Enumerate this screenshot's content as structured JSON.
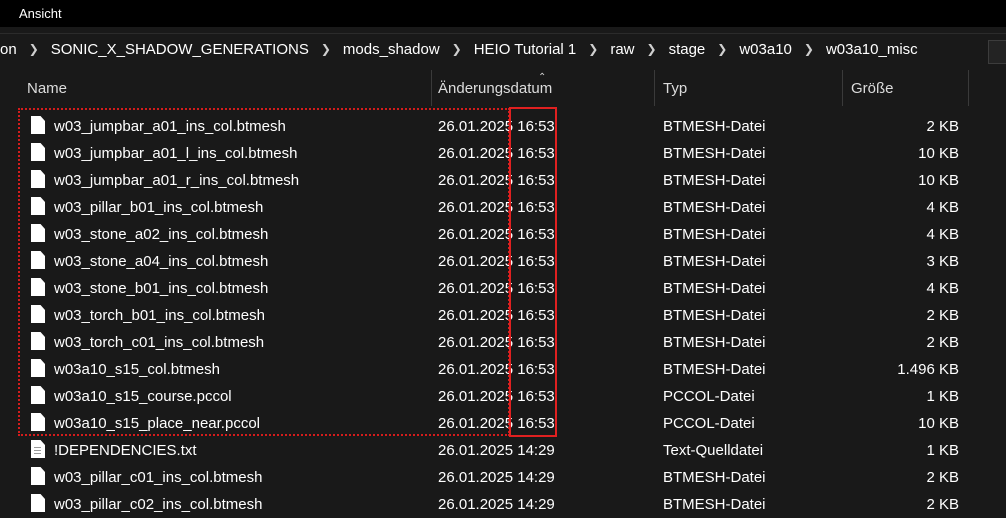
{
  "menubar": {
    "view_label": "Ansicht"
  },
  "breadcrumb": {
    "items": [
      "on",
      "SONIC_X_SHADOW_GENERATIONS",
      "mods_shadow",
      "HEIO Tutorial 1",
      "raw",
      "stage",
      "w03a10",
      "w03a10_misc"
    ]
  },
  "columns": {
    "name": "Name",
    "date": "Änderungsdatum",
    "type": "Typ",
    "size": "Größe"
  },
  "sort": {
    "column": "date",
    "indicator": "chevron-up-icon"
  },
  "files": [
    {
      "name": "w03_jumpbar_a01_ins_col.btmesh",
      "date": "26.01.2025 16:53",
      "type": "BTMESH-Datei",
      "size": "2 KB",
      "icon": "file-icon"
    },
    {
      "name": "w03_jumpbar_a01_l_ins_col.btmesh",
      "date": "26.01.2025 16:53",
      "type": "BTMESH-Datei",
      "size": "10 KB",
      "icon": "file-icon"
    },
    {
      "name": "w03_jumpbar_a01_r_ins_col.btmesh",
      "date": "26.01.2025 16:53",
      "type": "BTMESH-Datei",
      "size": "10 KB",
      "icon": "file-icon"
    },
    {
      "name": "w03_pillar_b01_ins_col.btmesh",
      "date": "26.01.2025 16:53",
      "type": "BTMESH-Datei",
      "size": "4 KB",
      "icon": "file-icon"
    },
    {
      "name": "w03_stone_a02_ins_col.btmesh",
      "date": "26.01.2025 16:53",
      "type": "BTMESH-Datei",
      "size": "4 KB",
      "icon": "file-icon"
    },
    {
      "name": "w03_stone_a04_ins_col.btmesh",
      "date": "26.01.2025 16:53",
      "type": "BTMESH-Datei",
      "size": "3 KB",
      "icon": "file-icon"
    },
    {
      "name": "w03_stone_b01_ins_col.btmesh",
      "date": "26.01.2025 16:53",
      "type": "BTMESH-Datei",
      "size": "4 KB",
      "icon": "file-icon"
    },
    {
      "name": "w03_torch_b01_ins_col.btmesh",
      "date": "26.01.2025 16:53",
      "type": "BTMESH-Datei",
      "size": "2 KB",
      "icon": "file-icon"
    },
    {
      "name": "w03_torch_c01_ins_col.btmesh",
      "date": "26.01.2025 16:53",
      "type": "BTMESH-Datei",
      "size": "2 KB",
      "icon": "file-icon"
    },
    {
      "name": "w03a10_s15_col.btmesh",
      "date": "26.01.2025 16:53",
      "type": "BTMESH-Datei",
      "size": "1.496 KB",
      "icon": "file-icon"
    },
    {
      "name": "w03a10_s15_course.pccol",
      "date": "26.01.2025 16:53",
      "type": "PCCOL-Datei",
      "size": "1 KB",
      "icon": "file-icon"
    },
    {
      "name": "w03a10_s15_place_near.pccol",
      "date": "26.01.2025 16:53",
      "type": "PCCOL-Datei",
      "size": "10 KB",
      "icon": "file-icon"
    },
    {
      "name": "!DEPENDENCIES.txt",
      "date": "26.01.2025 14:29",
      "type": "Text-Quelldatei",
      "size": "1 KB",
      "icon": "text-file-icon"
    },
    {
      "name": "w03_pillar_c01_ins_col.btmesh",
      "date": "26.01.2025 14:29",
      "type": "BTMESH-Datei",
      "size": "2 KB",
      "icon": "file-icon"
    },
    {
      "name": "w03_pillar_c02_ins_col.btmesh",
      "date": "26.01.2025 14:29",
      "type": "BTMESH-Datei",
      "size": "2 KB",
      "icon": "file-icon"
    }
  ],
  "highlight": {
    "dotted_color": "#d41c1c",
    "solid_color": "#e02020"
  }
}
